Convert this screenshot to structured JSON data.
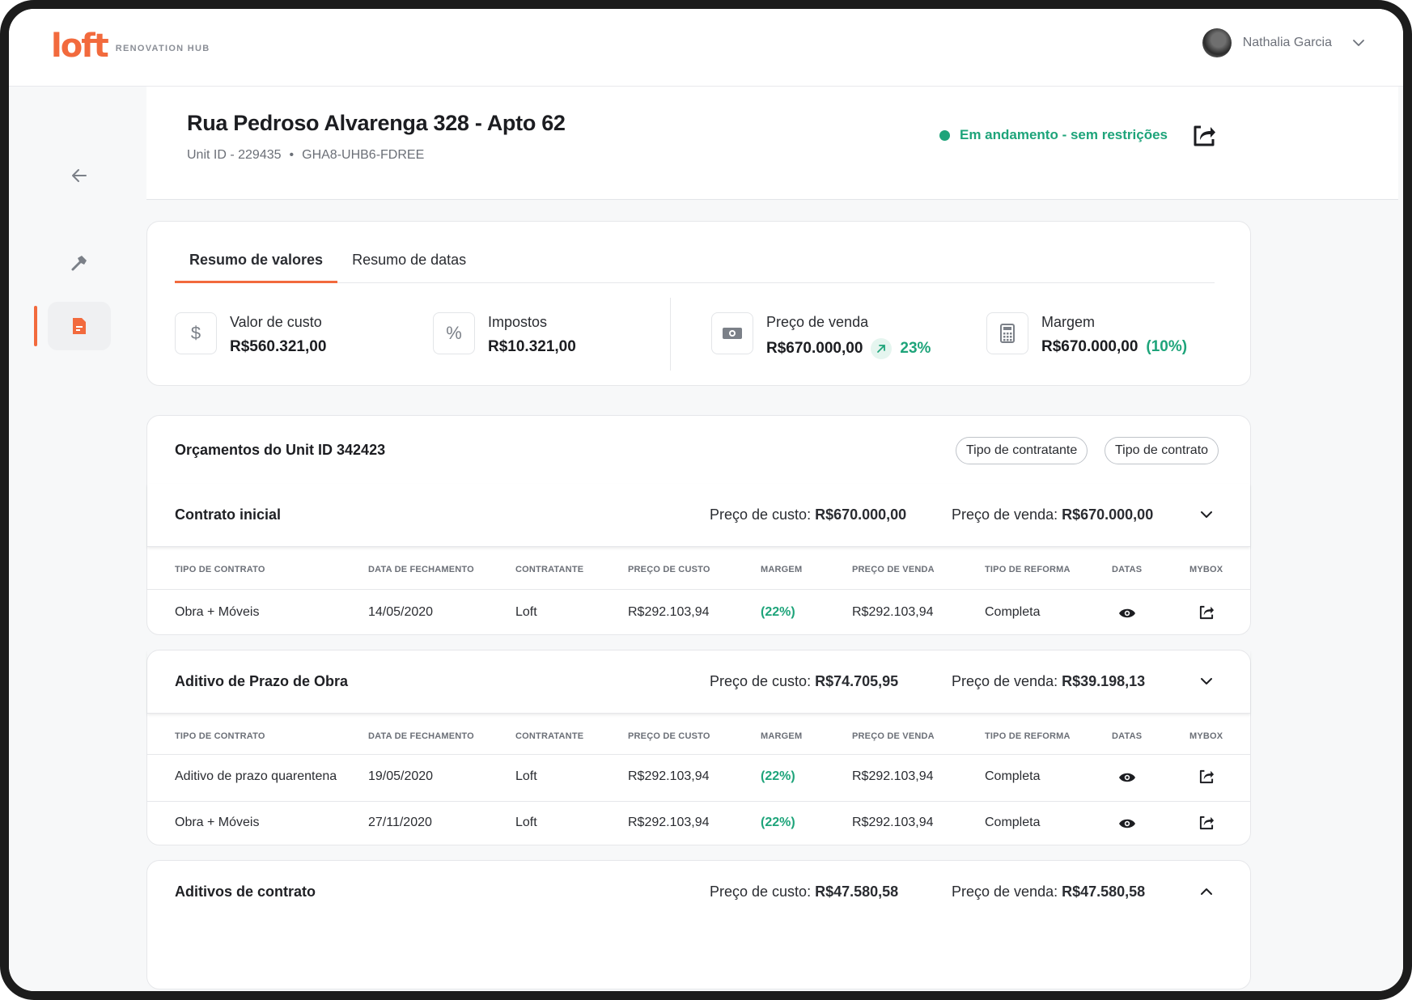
{
  "app": {
    "logo_text": "loft",
    "logo_sub": "RENOVATION HUB",
    "user_name": "Nathalia Garcia"
  },
  "header": {
    "title": "Rua Pedroso Alvarenga 328 - Apto 62",
    "unit_id": "Unit ID - 229435",
    "separator": "•",
    "code": "GHA8-UHB6-FDREE",
    "status": "Em andamento - sem restrições"
  },
  "summary": {
    "tabs": [
      "Resumo de valores",
      "Resumo de datas"
    ],
    "kpis": [
      {
        "label": "Valor de custo",
        "value": "R$560.321,00",
        "icon": "$"
      },
      {
        "label": "Impostos",
        "value": "R$10.321,00",
        "icon": "%"
      },
      {
        "label": "Preço de venda",
        "value": "R$670.000,00",
        "trend": "23%"
      },
      {
        "label": "Margem",
        "value": "R$670.000,00",
        "pct": "(10%)"
      }
    ]
  },
  "budgets": {
    "title": "Orçamentos do Unit ID 342423",
    "filters": [
      "Tipo de contratante",
      "Tipo de contrato"
    ],
    "columns": [
      "TIPO DE CONTRATO",
      "DATA DE FECHAMENTO",
      "CONTRATANTE",
      "PREÇO DE CUSTO",
      "MARGEM",
      "PREÇO DE VENDA",
      "TIPO DE REFORMA",
      "DATAS",
      "MYBOX"
    ],
    "cost_label": "Preço de custo:",
    "sale_label": "Preço de venda:",
    "groups": [
      {
        "name": "Contrato inicial",
        "cost": "R$670.000,00",
        "sale": "R$670.000,00",
        "rows": [
          [
            "Obra + Móveis",
            "14/05/2020",
            "Loft",
            "R$292.103,94",
            "(22%)",
            "R$292.103,94",
            "Completa"
          ]
        ]
      },
      {
        "name": "Aditivo de Prazo de Obra",
        "cost": "R$74.705,95",
        "sale": "R$39.198,13",
        "rows": [
          [
            "Aditivo de prazo quarentena",
            "19/05/2020",
            "Loft",
            "R$292.103,94",
            "(22%)",
            "R$292.103,94",
            "Completa"
          ],
          [
            "Obra + Móveis",
            "27/11/2020",
            "Loft",
            "R$292.103,94",
            "(22%)",
            "R$292.103,94",
            "Completa"
          ]
        ]
      },
      {
        "name": "Aditivos de contrato",
        "cost": "R$47.580,58",
        "sale": "R$47.580,58",
        "rows": []
      }
    ]
  },
  "colors": {
    "accent": "#f26a3d",
    "success": "#1ea47a"
  }
}
